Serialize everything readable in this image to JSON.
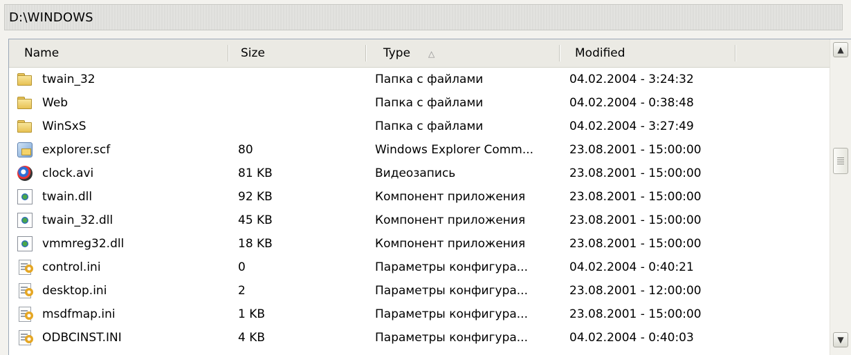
{
  "path": "D:\\WINDOWS",
  "columns": {
    "name": "Name",
    "size": "Size",
    "type": "Type",
    "type_sort_indicator": "△",
    "modified": "Modified"
  },
  "rows": [
    {
      "name": "twain_32",
      "size": "",
      "type": "Папка с файлами",
      "modified": "04.02.2004 - 3:24:32",
      "icon": "folder-icon"
    },
    {
      "name": "Web",
      "size": "",
      "type": "Папка с файлами",
      "modified": "04.02.2004 - 0:38:48",
      "icon": "folder-icon"
    },
    {
      "name": "WinSxS",
      "size": "",
      "type": "Папка с файлами",
      "modified": "04.02.2004 - 3:27:49",
      "icon": "folder-icon"
    },
    {
      "name": "explorer.scf",
      "size": "80",
      "type": "Windows Explorer Comm...",
      "modified": "23.08.2001 - 15:00:00",
      "icon": "explorer-command-icon"
    },
    {
      "name": "clock.avi",
      "size": "81 KB",
      "type": "Видеозапись",
      "modified": "23.08.2001 - 15:00:00",
      "icon": "video-file-icon"
    },
    {
      "name": "twain.dll",
      "size": "92 KB",
      "type": "Компонент приложения",
      "modified": "23.08.2001 - 15:00:00",
      "icon": "dll-file-icon"
    },
    {
      "name": "twain_32.dll",
      "size": "45 KB",
      "type": "Компонент приложения",
      "modified": "23.08.2001 - 15:00:00",
      "icon": "dll-file-icon"
    },
    {
      "name": "vmmreg32.dll",
      "size": "18 KB",
      "type": "Компонент приложения",
      "modified": "23.08.2001 - 15:00:00",
      "icon": "dll-file-icon"
    },
    {
      "name": "control.ini",
      "size": "0",
      "type": "Параметры конфигура...",
      "modified": "04.02.2004 - 0:40:21",
      "icon": "ini-file-icon"
    },
    {
      "name": "desktop.ini",
      "size": "2",
      "type": "Параметры конфигура...",
      "modified": "23.08.2001 - 12:00:00",
      "icon": "ini-file-icon"
    },
    {
      "name": "msdfmap.ini",
      "size": "1 KB",
      "type": "Параметры конфигура...",
      "modified": "23.08.2001 - 15:00:00",
      "icon": "ini-file-icon"
    },
    {
      "name": "ODBCINST.INI",
      "size": "4 KB",
      "type": "Параметры конфигура...",
      "modified": "04.02.2004 - 0:40:03",
      "icon": "ini-file-icon"
    }
  ],
  "scrollbar": {
    "up_icon": "scroll-up-icon",
    "down_icon": "scroll-down-icon",
    "up_glyph": "▲",
    "down_glyph": "▼"
  }
}
